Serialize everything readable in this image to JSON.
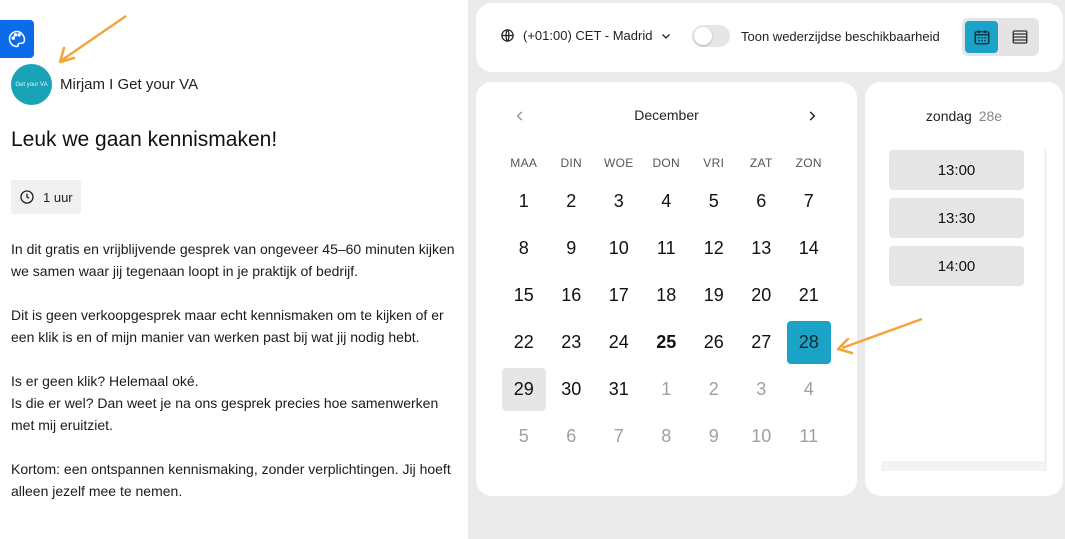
{
  "host": {
    "avatar_text": "Get your VA",
    "name": "Mirjam I Get your VA"
  },
  "event": {
    "title": "Leuk we gaan kennismaken!",
    "duration": "1 uur",
    "description": [
      "In dit gratis en vrijblijvende gesprek van ongeveer 45–60 minuten kijken we samen waar jij tegenaan loopt in je praktijk of bedrijf.",
      "Dit is geen verkoopgesprek maar echt kennismaken om te kijken of er een klik is en of mijn manier van werken past bij wat jij nodig hebt.",
      "Is er geen klik? Helemaal oké.\nIs die er wel? Dan weet je na ons gesprek precies hoe samenwerken met mij eruitziet.",
      "Kortom: een ontspannen kennismaking, zonder verplichtingen. Jij hoeft alleen jezelf mee te nemen."
    ]
  },
  "topbar": {
    "timezone": "(+01:00) CET - Madrid",
    "availability_toggle_label": "Toon wederzijdse beschikbaarheid",
    "availability_toggle_on": false,
    "active_view": "calendar"
  },
  "calendar": {
    "month": "December",
    "weekdays": [
      "MAA",
      "DIN",
      "WOE",
      "DON",
      "VRI",
      "ZAT",
      "ZON"
    ],
    "weeks": [
      [
        1,
        2,
        3,
        4,
        5,
        6,
        7
      ],
      [
        8,
        9,
        10,
        11,
        12,
        13,
        14
      ],
      [
        15,
        16,
        17,
        18,
        19,
        20,
        21
      ],
      [
        22,
        23,
        24,
        25,
        26,
        27,
        28
      ],
      [
        29,
        30,
        31,
        1,
        2,
        3,
        4
      ],
      [
        5,
        6,
        7,
        8,
        9,
        10,
        11
      ]
    ],
    "muted_from_index": 31,
    "today": 25,
    "selected": 28,
    "hovered": 29
  },
  "times": {
    "day_name": "zondag",
    "day_number": "28e",
    "slots": [
      "13:00",
      "13:30",
      "14:00"
    ]
  },
  "colors": {
    "accent": "#1aa3c7",
    "theme_button": "#0a6ce8",
    "avatar": "#1aa3b7",
    "annotation_arrow": "#f5a43a"
  }
}
